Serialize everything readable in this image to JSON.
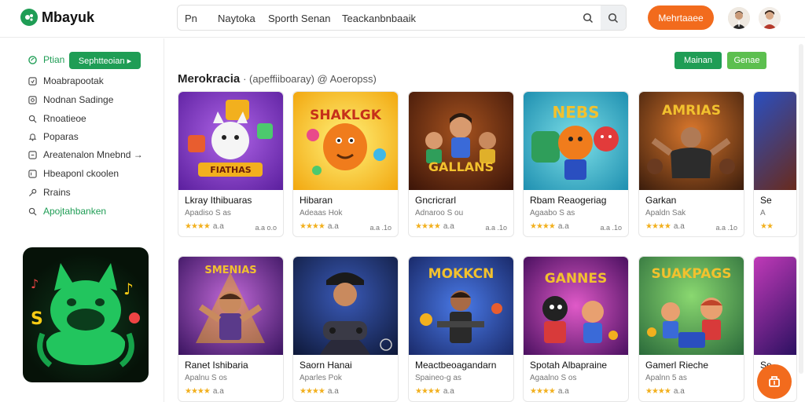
{
  "app": {
    "logo_text": "Mbayuk"
  },
  "top_nav": {
    "items": [
      "Pn",
      "Naytoka",
      "Sporth Senan",
      "Teackanbnbaaik"
    ]
  },
  "header": {
    "cta_label": "Mehrtaaee"
  },
  "sidebar": {
    "items": [
      {
        "label": "Ptian",
        "icon": "leaf-icon"
      },
      {
        "label": "Moabrapootak",
        "icon": "box-icon"
      },
      {
        "label": "Nodnan Sadinge",
        "icon": "box-icon"
      },
      {
        "label": "Rnoatieoe",
        "icon": "search-icon"
      },
      {
        "label": "Poparas",
        "icon": "bell-icon"
      },
      {
        "label": "Areatenalon Mnebnd →",
        "icon": "box-icon"
      },
      {
        "label": "Hbeaponl ckoolen",
        "icon": "box-icon"
      },
      {
        "label": "Rrains",
        "icon": "key-icon"
      },
      {
        "label": "Apojtahbanken",
        "icon": "search-icon"
      }
    ],
    "pill_label": "Sephtteoian ▸"
  },
  "main": {
    "title": "Merokracia",
    "subtitle": "· (apeffiiboaray) @ Aoeropss)",
    "btn_primary": "Mainan",
    "btn_secondary": "Genae",
    "row1": [
      {
        "title": "Lkray Ithibuaras",
        "sub": "Apadiso S as",
        "stars": "★★★★",
        "rc": "a.a",
        "meta": "a.a o.o",
        "art_text": "FIATHAS"
      },
      {
        "title": "Hibaran",
        "sub": "Adeaas Hok",
        "stars": "★★★★",
        "rc": "a.a",
        "meta": "a.a .1o",
        "art_text": "SHAKLGK"
      },
      {
        "title": "Gncricrarl",
        "sub": "Adnaroo S ou",
        "stars": "★★★★",
        "rc": "a.a",
        "meta": "a.a .1o",
        "art_text": "GALLANS"
      },
      {
        "title": "Rbam Reaogeriag",
        "sub": "Agaabo S as",
        "stars": "★★★★",
        "rc": "a.a",
        "meta": "a.a .1o",
        "art_text": "NEBS"
      },
      {
        "title": "Garkan",
        "sub": "Apaldn Sak",
        "stars": "★★★★",
        "rc": "a.a",
        "meta": "a.a .1o",
        "art_text": "AMRIAS"
      },
      {
        "title": "Se",
        "sub": "A",
        "stars": "★★",
        "rc": "",
        "meta": "",
        "art_text": ""
      }
    ],
    "row2": [
      {
        "title": "Ranet Ishibaria",
        "sub": "Apalnu S os",
        "stars": "★★★★",
        "rc": "a.a",
        "meta": "",
        "art_text": "SMENIAS"
      },
      {
        "title": "Saorn Hanai",
        "sub": "Aparles Pok",
        "stars": "★★★★",
        "rc": "a.a",
        "meta": "",
        "art_text": ""
      },
      {
        "title": "Meactbeoagandarn",
        "sub": "Spaineo-g as",
        "stars": "★★★★",
        "rc": "a.a",
        "meta": "",
        "art_text": "MOKKCN"
      },
      {
        "title": "Spotah Albapraine",
        "sub": "Agaalno S os",
        "stars": "★★★★",
        "rc": "a.a",
        "meta": "",
        "art_text": "GANNES"
      },
      {
        "title": "Gamerl Rieche",
        "sub": "Apalnn 5 as",
        "stars": "★★★★",
        "rc": "a.a",
        "meta": "",
        "art_text": "SUAKPAGS"
      },
      {
        "title": "Se",
        "sub": "A",
        "stars": "★★",
        "rc": "",
        "meta": "",
        "art_text": ""
      }
    ]
  },
  "colors": {
    "accent_green": "#1f9d55",
    "accent_orange": "#f26b1d",
    "star": "#f2b01e"
  }
}
